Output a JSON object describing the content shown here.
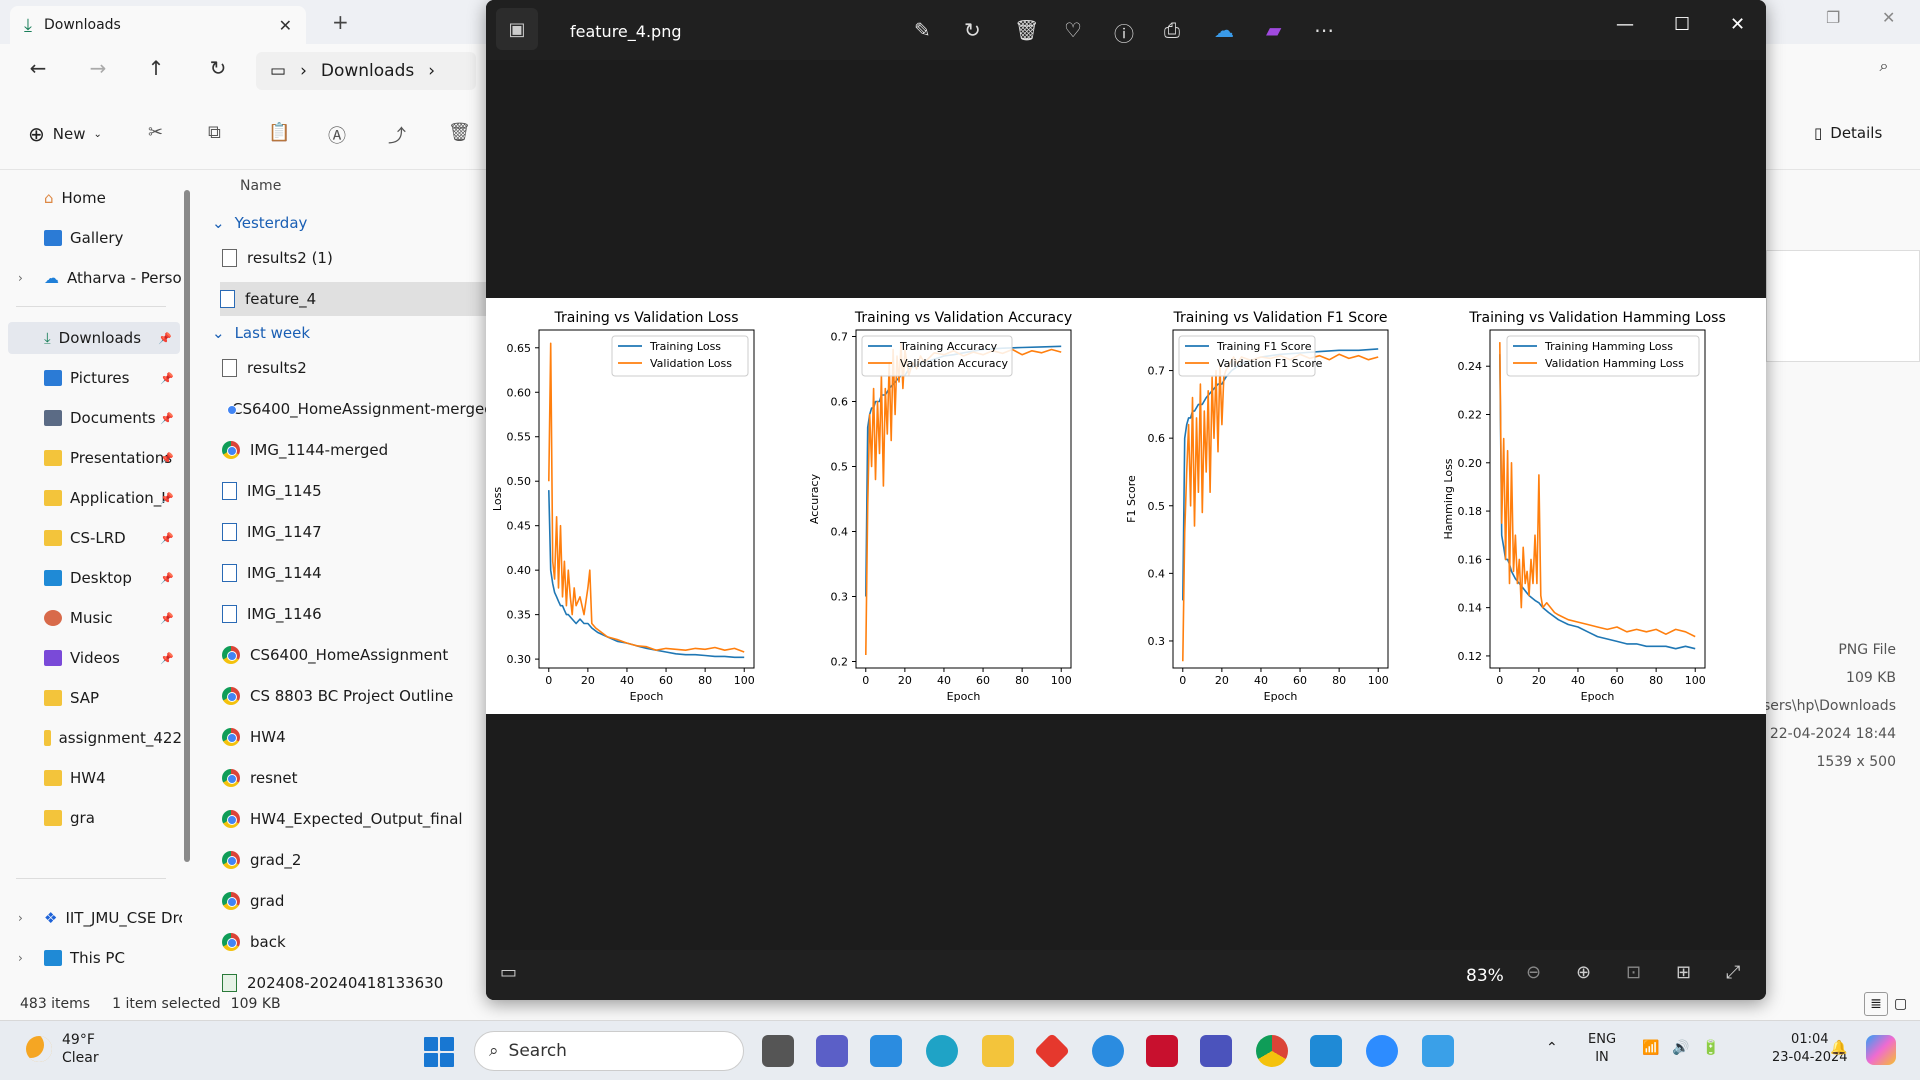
{
  "explorer": {
    "tab_title": "Downloads",
    "breadcrumb": "Downloads",
    "toolbar": {
      "new_label": "New",
      "details_label": "Details"
    },
    "sidebar": [
      {
        "label": "Home",
        "top": 0
      },
      {
        "label": "Gallery"
      },
      {
        "label": "Atharva - Persor"
      },
      {
        "label": "Downloads"
      },
      {
        "label": "Pictures"
      },
      {
        "label": "Documents"
      },
      {
        "label": "Presentations"
      },
      {
        "label": "Application_I"
      },
      {
        "label": "CS-LRD"
      },
      {
        "label": "Desktop"
      },
      {
        "label": "Music"
      },
      {
        "label": "Videos"
      },
      {
        "label": "SAP"
      },
      {
        "label": "assignment_422"
      },
      {
        "label": "HW4"
      },
      {
        "label": "gra"
      },
      {
        "label": "IIT_JMU_CSE Drc"
      },
      {
        "label": "This PC"
      }
    ],
    "column_name": "Name",
    "groups": {
      "yesterday": "Yesterday",
      "last_week": "Last week"
    },
    "files": [
      "results2 (1)",
      "feature_4",
      "results2",
      "CS6400_HomeAssignment-merged",
      "IMG_1144-merged",
      "IMG_1145",
      "IMG_1147",
      "IMG_1144",
      "IMG_1146",
      "CS6400_HomeAssignment",
      "CS 8803 BC Project Outline",
      "HW4",
      "resnet",
      "HW4_Expected_Output_final",
      "grad_2",
      "grad",
      "back",
      "202408-20240418133630"
    ],
    "status": {
      "items": "483 items",
      "selected": "1 item selected",
      "size": "109 KB"
    },
    "details": {
      "type": "PNG File",
      "size": "109 KB",
      "path": "sers\\hp\\Downloads",
      "date": "22-04-2024 18:44",
      "dims": "1539 x 500"
    }
  },
  "photos": {
    "filename": "feature_4.png",
    "zoom": "83%"
  },
  "chart_data": [
    {
      "type": "line",
      "title": "Training vs Validation Loss",
      "xlabel": "Epoch",
      "ylabel": "Loss",
      "xlim": [
        -5,
        105
      ],
      "ylim": [
        0.29,
        0.67
      ],
      "xticks": [
        0,
        20,
        40,
        60,
        80,
        100
      ],
      "yticks": [
        0.3,
        0.35,
        0.4,
        0.45,
        0.5,
        0.55,
        0.6,
        0.65
      ],
      "ytick_labels": [
        "0.30",
        "0.35",
        "0.40",
        "0.45",
        "0.50",
        "0.55",
        "0.60",
        "0.65"
      ],
      "legend": "top-right",
      "series": [
        {
          "name": "Training Loss",
          "color": "#1f77b4",
          "x": [
            0,
            1,
            2,
            3,
            4,
            5,
            6,
            7,
            8,
            9,
            10,
            12,
            14,
            16,
            18,
            20,
            22,
            25,
            30,
            35,
            40,
            45,
            50,
            55,
            60,
            65,
            70,
            75,
            80,
            85,
            90,
            95,
            100
          ],
          "y": [
            0.49,
            0.4,
            0.385,
            0.375,
            0.37,
            0.365,
            0.36,
            0.36,
            0.355,
            0.35,
            0.35,
            0.345,
            0.34,
            0.345,
            0.34,
            0.34,
            0.335,
            0.33,
            0.325,
            0.32,
            0.318,
            0.315,
            0.312,
            0.31,
            0.308,
            0.306,
            0.305,
            0.305,
            0.304,
            0.303,
            0.303,
            0.302,
            0.302
          ]
        },
        {
          "name": "Validation Loss",
          "color": "#ff7f0e",
          "x": [
            0,
            1,
            2,
            3,
            4,
            5,
            6,
            7,
            8,
            9,
            10,
            11,
            12,
            13,
            14,
            16,
            18,
            20,
            21,
            22,
            24,
            27,
            30,
            35,
            40,
            45,
            50,
            55,
            60,
            65,
            70,
            75,
            80,
            85,
            90,
            95,
            100
          ],
          "y": [
            0.5,
            0.655,
            0.41,
            0.39,
            0.46,
            0.38,
            0.45,
            0.37,
            0.41,
            0.36,
            0.4,
            0.37,
            0.35,
            0.38,
            0.36,
            0.37,
            0.35,
            0.38,
            0.4,
            0.34,
            0.335,
            0.33,
            0.325,
            0.322,
            0.318,
            0.315,
            0.314,
            0.31,
            0.312,
            0.311,
            0.31,
            0.312,
            0.311,
            0.313,
            0.31,
            0.312,
            0.308
          ]
        }
      ]
    },
    {
      "type": "line",
      "title": "Training vs Validation Accuracy",
      "xlabel": "Epoch",
      "ylabel": "Accuracy",
      "xlim": [
        -5,
        105
      ],
      "ylim": [
        0.19,
        0.71
      ],
      "xticks": [
        0,
        20,
        40,
        60,
        80,
        100
      ],
      "yticks": [
        0.2,
        0.3,
        0.4,
        0.5,
        0.6,
        0.7
      ],
      "ytick_labels": [
        "0.2",
        "0.3",
        "0.4",
        "0.5",
        "0.6",
        "0.7"
      ],
      "legend": "top-left",
      "series": [
        {
          "name": "Training Accuracy",
          "color": "#1f77b4",
          "x": [
            0,
            1,
            2,
            3,
            4,
            5,
            6,
            7,
            8,
            10,
            12,
            15,
            18,
            20,
            22,
            25,
            30,
            35,
            40,
            45,
            50,
            60,
            70,
            80,
            90,
            100
          ],
          "y": [
            0.3,
            0.56,
            0.58,
            0.59,
            0.59,
            0.6,
            0.6,
            0.6,
            0.61,
            0.61,
            0.62,
            0.63,
            0.64,
            0.64,
            0.65,
            0.655,
            0.66,
            0.665,
            0.67,
            0.672,
            0.675,
            0.68,
            0.682,
            0.683,
            0.684,
            0.685
          ]
        },
        {
          "name": "Validation Accuracy",
          "color": "#ff7f0e",
          "x": [
            0,
            1,
            2,
            3,
            4,
            5,
            6,
            7,
            8,
            9,
            10,
            11,
            12,
            13,
            14,
            15,
            16,
            17,
            18,
            19,
            20,
            22,
            24,
            26,
            28,
            30,
            35,
            40,
            45,
            50,
            55,
            60,
            65,
            70,
            75,
            80,
            85,
            90,
            95,
            100
          ],
          "y": [
            0.21,
            0.44,
            0.58,
            0.5,
            0.62,
            0.48,
            0.6,
            0.52,
            0.64,
            0.47,
            0.62,
            0.55,
            0.66,
            0.54,
            0.68,
            0.58,
            0.67,
            0.63,
            0.69,
            0.62,
            0.68,
            0.64,
            0.66,
            0.65,
            0.67,
            0.66,
            0.675,
            0.672,
            0.678,
            0.67,
            0.676,
            0.672,
            0.678,
            0.674,
            0.68,
            0.672,
            0.678,
            0.675,
            0.68,
            0.676
          ]
        }
      ]
    },
    {
      "type": "line",
      "title": "Training vs Validation F1 Score",
      "xlabel": "Epoch",
      "ylabel": "F1 Score",
      "xlim": [
        -5,
        105
      ],
      "ylim": [
        0.26,
        0.76
      ],
      "xticks": [
        0,
        20,
        40,
        60,
        80,
        100
      ],
      "yticks": [
        0.3,
        0.4,
        0.5,
        0.6,
        0.7
      ],
      "ytick_labels": [
        "0.3",
        "0.4",
        "0.5",
        "0.6",
        "0.7"
      ],
      "legend": "top-left",
      "series": [
        {
          "name": "Training F1 Score",
          "color": "#1f77b4",
          "x": [
            0,
            1,
            2,
            3,
            4,
            5,
            6,
            8,
            10,
            12,
            15,
            18,
            20,
            22,
            25,
            30,
            35,
            40,
            45,
            50,
            60,
            70,
            80,
            90,
            100
          ],
          "y": [
            0.36,
            0.6,
            0.62,
            0.63,
            0.63,
            0.64,
            0.64,
            0.65,
            0.65,
            0.66,
            0.67,
            0.68,
            0.68,
            0.69,
            0.7,
            0.71,
            0.715,
            0.72,
            0.722,
            0.724,
            0.726,
            0.728,
            0.73,
            0.73,
            0.732
          ]
        },
        {
          "name": "Validation F1 Score",
          "color": "#ff7f0e",
          "x": [
            0,
            1,
            2,
            3,
            4,
            5,
            6,
            7,
            8,
            9,
            10,
            11,
            12,
            13,
            14,
            15,
            16,
            17,
            18,
            19,
            20,
            21,
            22,
            24,
            26,
            28,
            30,
            35,
            40,
            45,
            50,
            55,
            60,
            65,
            70,
            75,
            80,
            85,
            90,
            95,
            100
          ],
          "y": [
            0.27,
            0.46,
            0.55,
            0.62,
            0.5,
            0.66,
            0.47,
            0.63,
            0.52,
            0.68,
            0.49,
            0.64,
            0.55,
            0.67,
            0.52,
            0.69,
            0.6,
            0.7,
            0.58,
            0.71,
            0.62,
            0.69,
            0.7,
            0.71,
            0.72,
            0.71,
            0.72,
            0.715,
            0.72,
            0.718,
            0.722,
            0.716,
            0.724,
            0.718,
            0.722,
            0.716,
            0.724,
            0.718,
            0.722,
            0.716,
            0.72
          ]
        }
      ]
    },
    {
      "type": "line",
      "title": "Training vs Validation Hamming Loss",
      "xlabel": "Epoch",
      "ylabel": "Hamming Loss",
      "xlim": [
        -5,
        105
      ],
      "ylim": [
        0.115,
        0.255
      ],
      "xticks": [
        0,
        20,
        40,
        60,
        80,
        100
      ],
      "yticks": [
        0.12,
        0.14,
        0.16,
        0.18,
        0.2,
        0.22,
        0.24
      ],
      "ytick_labels": [
        "0.12",
        "0.14",
        "0.16",
        "0.18",
        "0.20",
        "0.22",
        "0.24"
      ],
      "legend": "top-right",
      "series": [
        {
          "name": "Training Hamming Loss",
          "color": "#1f77b4",
          "x": [
            0,
            1,
            2,
            3,
            4,
            5,
            6,
            8,
            10,
            12,
            15,
            18,
            20,
            22,
            25,
            30,
            35,
            40,
            45,
            50,
            55,
            60,
            65,
            70,
            75,
            80,
            85,
            90,
            95,
            100
          ],
          "y": [
            0.245,
            0.17,
            0.165,
            0.16,
            0.16,
            0.158,
            0.155,
            0.152,
            0.15,
            0.148,
            0.145,
            0.143,
            0.142,
            0.14,
            0.138,
            0.135,
            0.133,
            0.132,
            0.13,
            0.128,
            0.127,
            0.126,
            0.125,
            0.125,
            0.124,
            0.124,
            0.124,
            0.123,
            0.124,
            0.123
          ]
        },
        {
          "name": "Validation Hamming Loss",
          "color": "#ff7f0e",
          "x": [
            0,
            1,
            2,
            3,
            4,
            5,
            6,
            7,
            8,
            9,
            10,
            11,
            12,
            13,
            14,
            15,
            16,
            17,
            18,
            19,
            20,
            21,
            22,
            24,
            26,
            28,
            30,
            35,
            40,
            45,
            50,
            55,
            60,
            65,
            70,
            75,
            80,
            85,
            90,
            95,
            100
          ],
          "y": [
            0.25,
            0.175,
            0.21,
            0.16,
            0.205,
            0.15,
            0.2,
            0.155,
            0.17,
            0.15,
            0.16,
            0.14,
            0.165,
            0.15,
            0.155,
            0.145,
            0.16,
            0.15,
            0.17,
            0.15,
            0.195,
            0.145,
            0.14,
            0.142,
            0.14,
            0.138,
            0.137,
            0.135,
            0.134,
            0.133,
            0.132,
            0.131,
            0.132,
            0.13,
            0.131,
            0.13,
            0.131,
            0.129,
            0.131,
            0.13,
            0.128
          ]
        }
      ]
    }
  ]
}
